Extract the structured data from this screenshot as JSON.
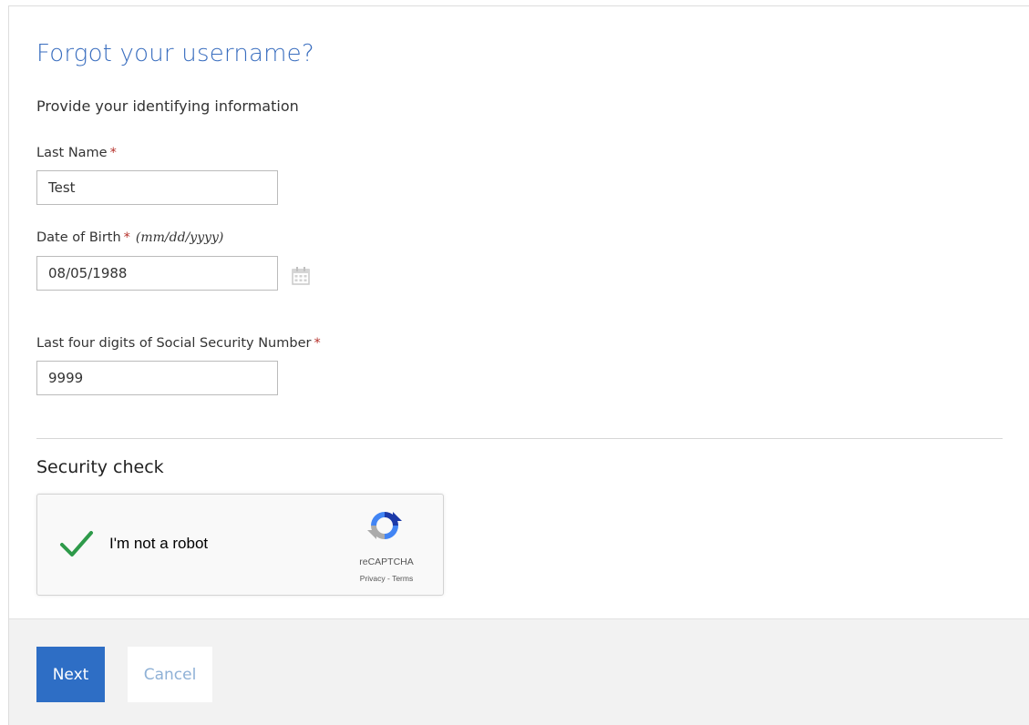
{
  "page": {
    "title": "Forgot your username?",
    "subtitle": "Provide your identifying information"
  },
  "form": {
    "last_name": {
      "label": "Last Name",
      "required": "*",
      "value": "Test"
    },
    "dob": {
      "label": "Date of Birth",
      "required": "*",
      "hint": "(mm/dd/yyyy)",
      "value": "08/05/1988",
      "icon": "calendar-icon"
    },
    "ssn": {
      "label": "Last four digits of Social Security Number",
      "required": "*",
      "value": "9999"
    }
  },
  "security": {
    "title": "Security check",
    "captcha": {
      "label": "I'm not a robot",
      "checked": true,
      "brand": "reCAPTCHA",
      "privacy": "Privacy",
      "separator": " - ",
      "terms": "Terms"
    }
  },
  "actions": {
    "next_label": "Next",
    "cancel_label": "Cancel"
  },
  "colors": {
    "accent": "#2e6ec5",
    "title": "#3a6ebf",
    "required": "#b5312b",
    "check": "#2e9a4a"
  }
}
